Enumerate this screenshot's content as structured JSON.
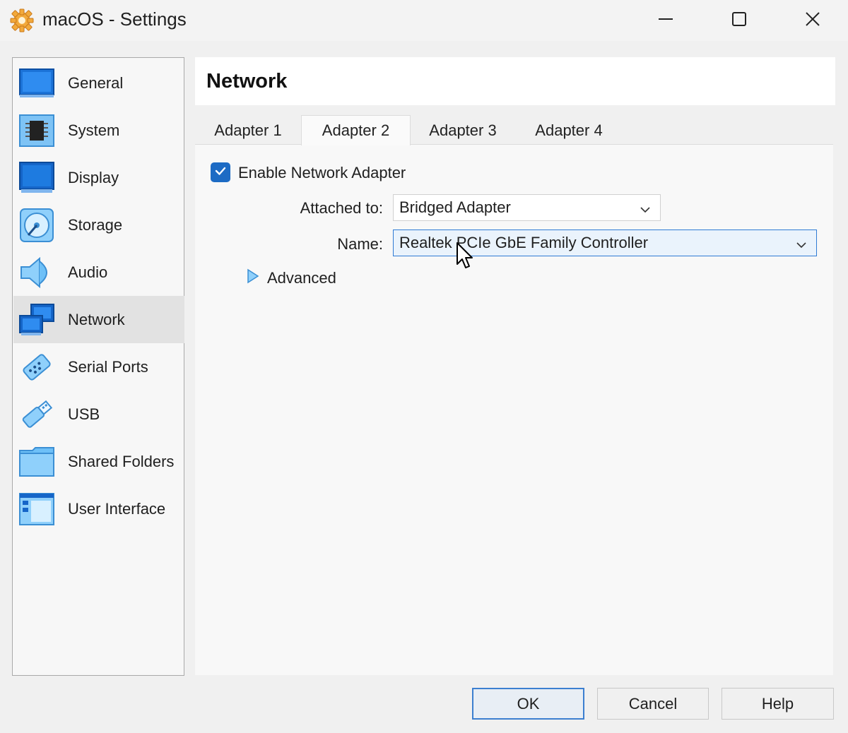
{
  "window": {
    "title": "macOS - Settings",
    "app_icon": "gear-icon",
    "controls": [
      "minimize-icon",
      "maximize-icon",
      "close-icon"
    ]
  },
  "sidebar": {
    "items": [
      {
        "label": "General",
        "icon": "general-icon"
      },
      {
        "label": "System",
        "icon": "system-chip-icon"
      },
      {
        "label": "Display",
        "icon": "display-monitor-icon"
      },
      {
        "label": "Storage",
        "icon": "storage-disk-icon"
      },
      {
        "label": "Audio",
        "icon": "audio-speaker-icon"
      },
      {
        "label": "Network",
        "icon": "network-icon",
        "active": true
      },
      {
        "label": "Serial Ports",
        "icon": "serial-port-icon"
      },
      {
        "label": "USB",
        "icon": "usb-icon"
      },
      {
        "label": "Shared Folders",
        "icon": "folder-icon"
      },
      {
        "label": "User Interface",
        "icon": "user-interface-icon"
      }
    ]
  },
  "page": {
    "title": "Network",
    "tabs": [
      {
        "label": "Adapter 1"
      },
      {
        "label": "Adapter 2",
        "active": true
      },
      {
        "label": "Adapter 3"
      },
      {
        "label": "Adapter 4"
      }
    ],
    "enable_adapter": {
      "label": "Enable Network Adapter",
      "checked": true
    },
    "attached_to": {
      "label": "Attached to:",
      "value": "Bridged Adapter"
    },
    "name": {
      "label": "Name:",
      "value": "Realtek PCIe GbE Family Controller"
    },
    "advanced": {
      "label": "Advanced",
      "icon": "triangle-right-icon"
    }
  },
  "footer": {
    "ok": "OK",
    "cancel": "Cancel",
    "help": "Help"
  },
  "colors": {
    "accent": "#1d6bc4",
    "selected_item": "#e2e2e2",
    "focus_border": "#2f7bd4"
  }
}
